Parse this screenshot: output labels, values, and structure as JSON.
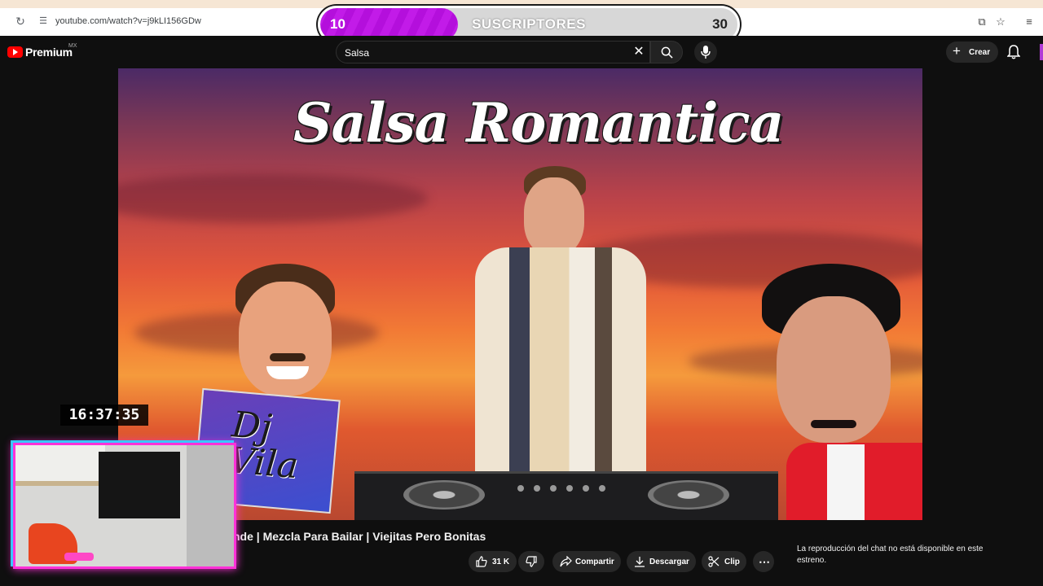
{
  "browser": {
    "url": "youtube.com/watch?v=j9kLI156GDw"
  },
  "subscriber_goal": {
    "current": "10",
    "label": "SUSCRIPTORES",
    "goal": "30",
    "progress_fraction": 0.33,
    "fill_color": "#c21be8"
  },
  "youtube": {
    "brand": "Premium",
    "country": "MX",
    "search_value": "Salsa",
    "create_label": "Crear",
    "accent_color": "#ff0000"
  },
  "video": {
    "frame_title": "Salsa Romantica",
    "dj_logo": "Dj Vila",
    "title": "nde | Mezcla Para Bailar | Viejitas Pero Bonitas"
  },
  "actions": {
    "likes": "31 K",
    "share": "Compartir",
    "download": "Descargar",
    "clip": "Clip"
  },
  "chat": {
    "notice": "La reproducción del chat no está disponible en este estreno."
  },
  "overlay": {
    "clock": "16:37:35"
  }
}
